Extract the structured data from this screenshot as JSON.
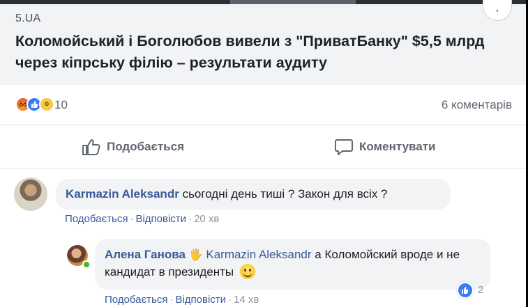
{
  "post": {
    "source": "5.UA",
    "headline": "Коломойський і Боголюбов вивели з \"ПриватБанку\" $5,5 млрд через кіпрську філію – результати аудиту",
    "reactions": {
      "icons": [
        "angry-icon",
        "like-icon",
        "wow-icon"
      ],
      "count": "10"
    },
    "comments_count": "6 коментарів",
    "actions": {
      "like_label": "Подобається",
      "comment_label": "Коментувати"
    }
  },
  "comments": [
    {
      "author": "Karmazin Aleksandr",
      "text": "сьогодні день тиші ? Закон для всіх ?",
      "like_label": "Подобається",
      "reply_label": "Відповісти",
      "time": "20 хв"
    },
    {
      "author": "Алена Ганова",
      "mention": "Karmazin Aleksandr",
      "text": "а Коломойский вроде и не кандидат в президенты",
      "like_label": "Подобається",
      "reply_label": "Відповісти",
      "time": "14 хв",
      "likes": "2",
      "online": true
    }
  ],
  "colors": {
    "link": "#385898",
    "muted": "#90949c",
    "bubble": "#f2f3f5",
    "like_blue": "#3b7cf5",
    "online_green": "#42b72a"
  }
}
